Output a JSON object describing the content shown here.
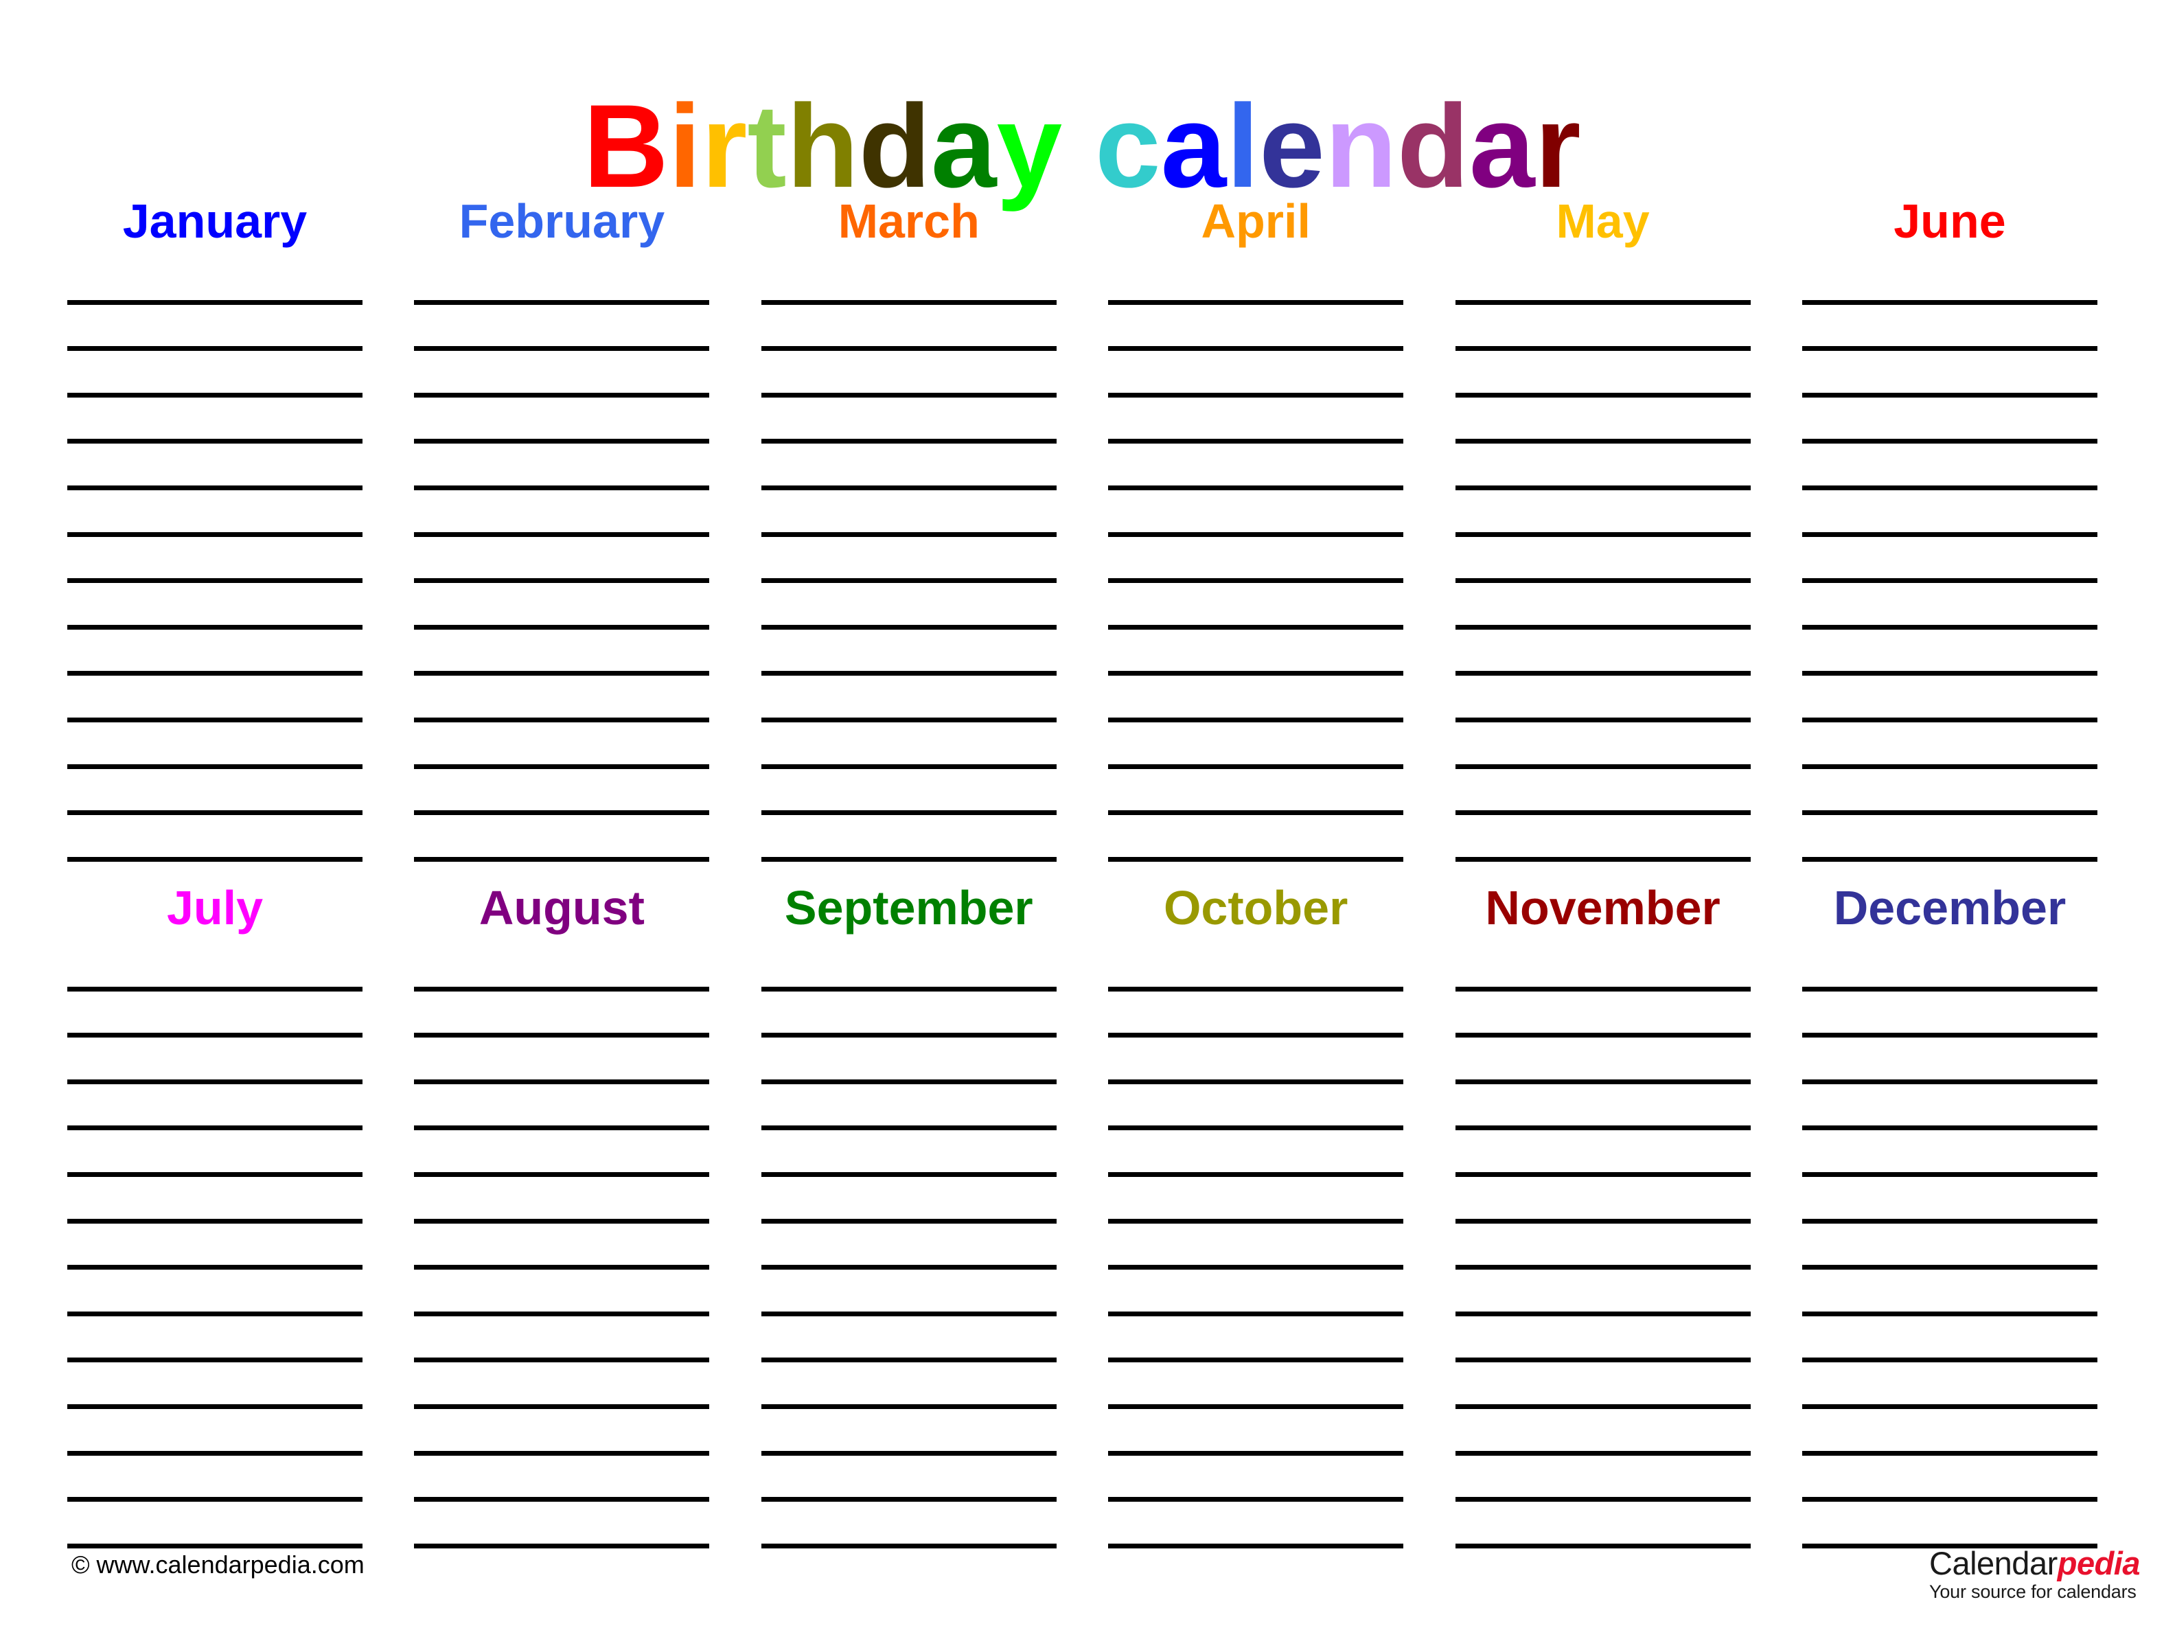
{
  "document": {
    "title": "Birthday calendar",
    "title_letters": [
      {
        "char": "B",
        "color": "#FF0000"
      },
      {
        "char": "i",
        "color": "#FF6600"
      },
      {
        "char": "r",
        "color": "#FFC000"
      },
      {
        "char": "t",
        "color": "#92D050"
      },
      {
        "char": "h",
        "color": "#808000"
      },
      {
        "char": "d",
        "color": "#3F3300"
      },
      {
        "char": "a",
        "color": "#008000"
      },
      {
        "char": "y",
        "color": "#00FF00"
      },
      {
        "char": " ",
        "color": "#000000"
      },
      {
        "char": "c",
        "color": "#33CCCC"
      },
      {
        "char": "a",
        "color": "#0000FF"
      },
      {
        "char": "l",
        "color": "#3366EE"
      },
      {
        "char": "e",
        "color": "#333399"
      },
      {
        "char": "n",
        "color": "#CC99FF"
      },
      {
        "char": "d",
        "color": "#993366"
      },
      {
        "char": "a",
        "color": "#800080"
      },
      {
        "char": "r",
        "color": "#800000"
      }
    ]
  },
  "calendar": {
    "lines_per_month": 13,
    "rows": [
      {
        "months": [
          {
            "name": "January",
            "color": "#0000FF"
          },
          {
            "name": "February",
            "color": "#3366EE"
          },
          {
            "name": "March",
            "color": "#FF6600"
          },
          {
            "name": "April",
            "color": "#FF9900"
          },
          {
            "name": "May",
            "color": "#FFC000"
          },
          {
            "name": "June",
            "color": "#FF0000"
          }
        ]
      },
      {
        "months": [
          {
            "name": "July",
            "color": "#FF00FF"
          },
          {
            "name": "August",
            "color": "#800080"
          },
          {
            "name": "September",
            "color": "#008000"
          },
          {
            "name": "October",
            "color": "#999900"
          },
          {
            "name": "November",
            "color": "#990000"
          },
          {
            "name": "December",
            "color": "#333399"
          }
        ]
      }
    ]
  },
  "footer": {
    "copyright": "© www.calendarpedia.com",
    "logo": {
      "name_part1": "Calendar",
      "name_part2": "pedia",
      "tagline": "Your source for calendars"
    }
  }
}
